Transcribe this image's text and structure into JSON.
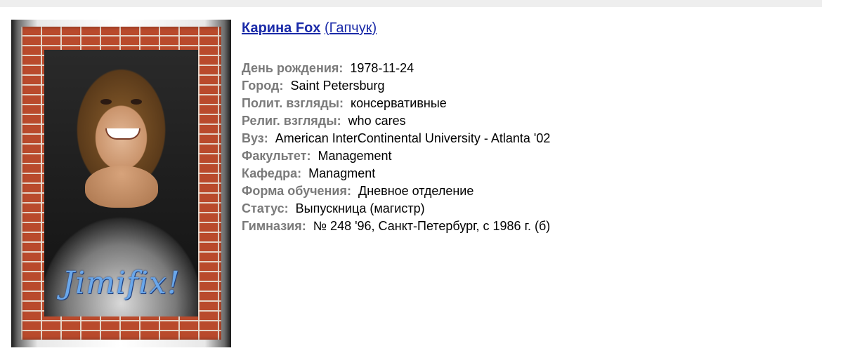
{
  "profile": {
    "name": "Карина Fox",
    "maiden_name": "(Гапчук)",
    "photo_watermark": "Jimifix!"
  },
  "fields": [
    {
      "label": "День рождения:",
      "value": "1978-11-24"
    },
    {
      "label": "Город:",
      "value": "Saint Petersburg"
    },
    {
      "label": "Полит. взгляды:",
      "value": "консервативные"
    },
    {
      "label": "Религ. взгляды:",
      "value": "who cares"
    },
    {
      "label": "Вуз:",
      "value": "American InterContinental University - Atlanta '02"
    },
    {
      "label": "Факультет:",
      "value": "Management"
    },
    {
      "label": "Кафедра:",
      "value": "Managment"
    },
    {
      "label": "Форма обучения:",
      "value": "Дневное отделение"
    },
    {
      "label": "Статус:",
      "value": "Выпускница (магистр)"
    },
    {
      "label": "Гимназия:",
      "value": "№ 248 '96, Санкт-Петербург, с 1986 г. (б)"
    }
  ],
  "colors": {
    "link": "#1a2aa8",
    "label": "#7a7a7a",
    "brick": "#b94a2c"
  }
}
